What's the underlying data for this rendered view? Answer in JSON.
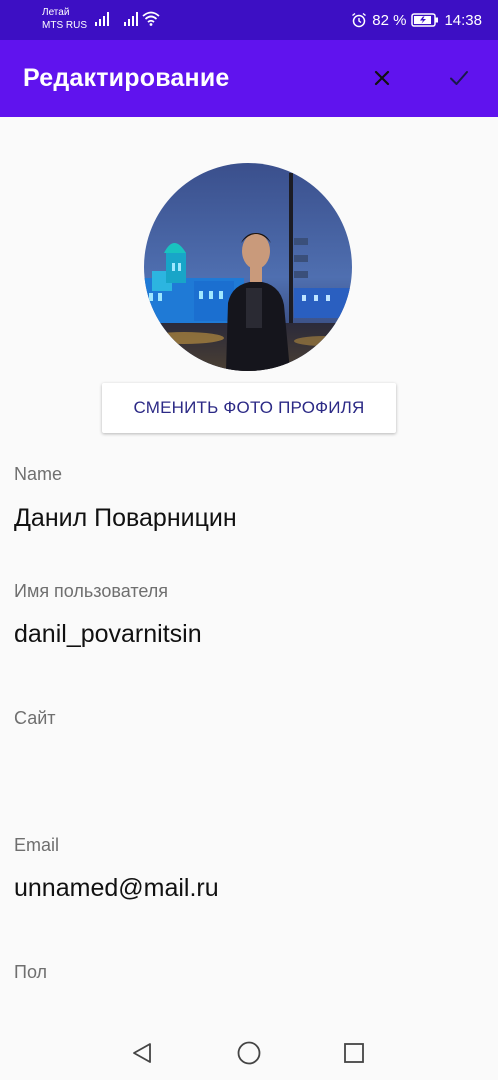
{
  "status_bar": {
    "carrier_line1": "Летай",
    "carrier_line2": "MTS RUS",
    "battery_percent": "82 %",
    "time": "14:38",
    "icons": [
      "signal-icon",
      "signal-icon",
      "wifi-icon",
      "alarm-icon",
      "battery-charging-icon"
    ]
  },
  "app_bar": {
    "title": "Редактирование",
    "close_icon": "close-icon",
    "confirm_icon": "check-icon"
  },
  "profile": {
    "change_photo_label": "СМЕНИТЬ ФОТО ПРОФИЛЯ"
  },
  "fields": {
    "name": {
      "label": "Name",
      "value": "Данил Поварницин"
    },
    "username": {
      "label": "Имя пользователя",
      "value": "danil_povarnitsin"
    },
    "website": {
      "label": "Сайт",
      "value": ""
    },
    "email": {
      "label": "Email",
      "value": "unnamed@mail.ru"
    },
    "gender": {
      "label": "Пол",
      "value": ""
    }
  },
  "nav_bar": {
    "icons": [
      "back-icon",
      "home-icon",
      "recents-icon"
    ]
  },
  "colors": {
    "status_bar": "#3d0fc4",
    "app_bar": "#6013ee",
    "button_text": "#2c2a86",
    "background": "#fafafa"
  }
}
